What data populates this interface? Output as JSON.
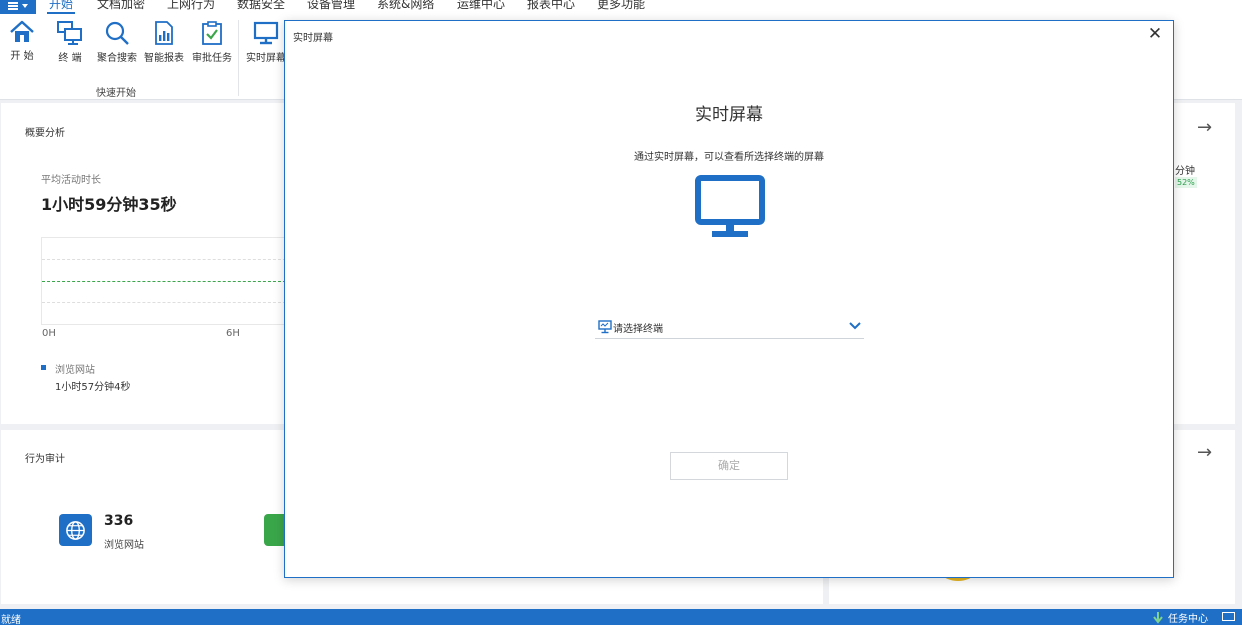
{
  "menu": {
    "items": [
      "开始",
      "文档加密",
      "上网行为",
      "数据安全",
      "设备管理",
      "系统&网络",
      "运维中心",
      "报表中心",
      "更多功能"
    ],
    "active_index": 0
  },
  "ribbon": {
    "buttons": [
      {
        "label": "开 始",
        "icon": "home-icon"
      },
      {
        "label": "终 端",
        "icon": "terminals-icon"
      },
      {
        "label": "聚合搜索",
        "icon": "search-icon"
      },
      {
        "label": "智能报表",
        "icon": "report-icon"
      },
      {
        "label": "审批任务",
        "icon": "approval-icon"
      },
      {
        "label": "实时屏幕",
        "icon": "monitor-icon"
      }
    ],
    "group_label": "快速开始"
  },
  "overview": {
    "title": "概要分析",
    "avg_label": "平均活动时长",
    "avg_value": "1小时59分钟35秒",
    "ticks": [
      "0H",
      "6H"
    ],
    "legend_name": "浏览网站",
    "legend_value": "1小时57分钟4秒",
    "right_fragment_value": "分钟",
    "right_fragment_badge": "52%"
  },
  "behavior": {
    "title": "行为审计",
    "stat_value": "336",
    "stat_label": "浏览网站"
  },
  "dialog": {
    "title": "实时屏幕",
    "heading": "实时屏幕",
    "description": "通过实时屏幕，可以查看所选择终端的屏幕",
    "select_placeholder": "请选择终端",
    "ok_label": "确定",
    "close_symbol": "✕"
  },
  "statusbar": {
    "text": "就绪",
    "task_center": "任务中心"
  },
  "colors": {
    "accent": "#1f6fc6",
    "green": "#3aa64a",
    "gold": "#e6b523"
  }
}
